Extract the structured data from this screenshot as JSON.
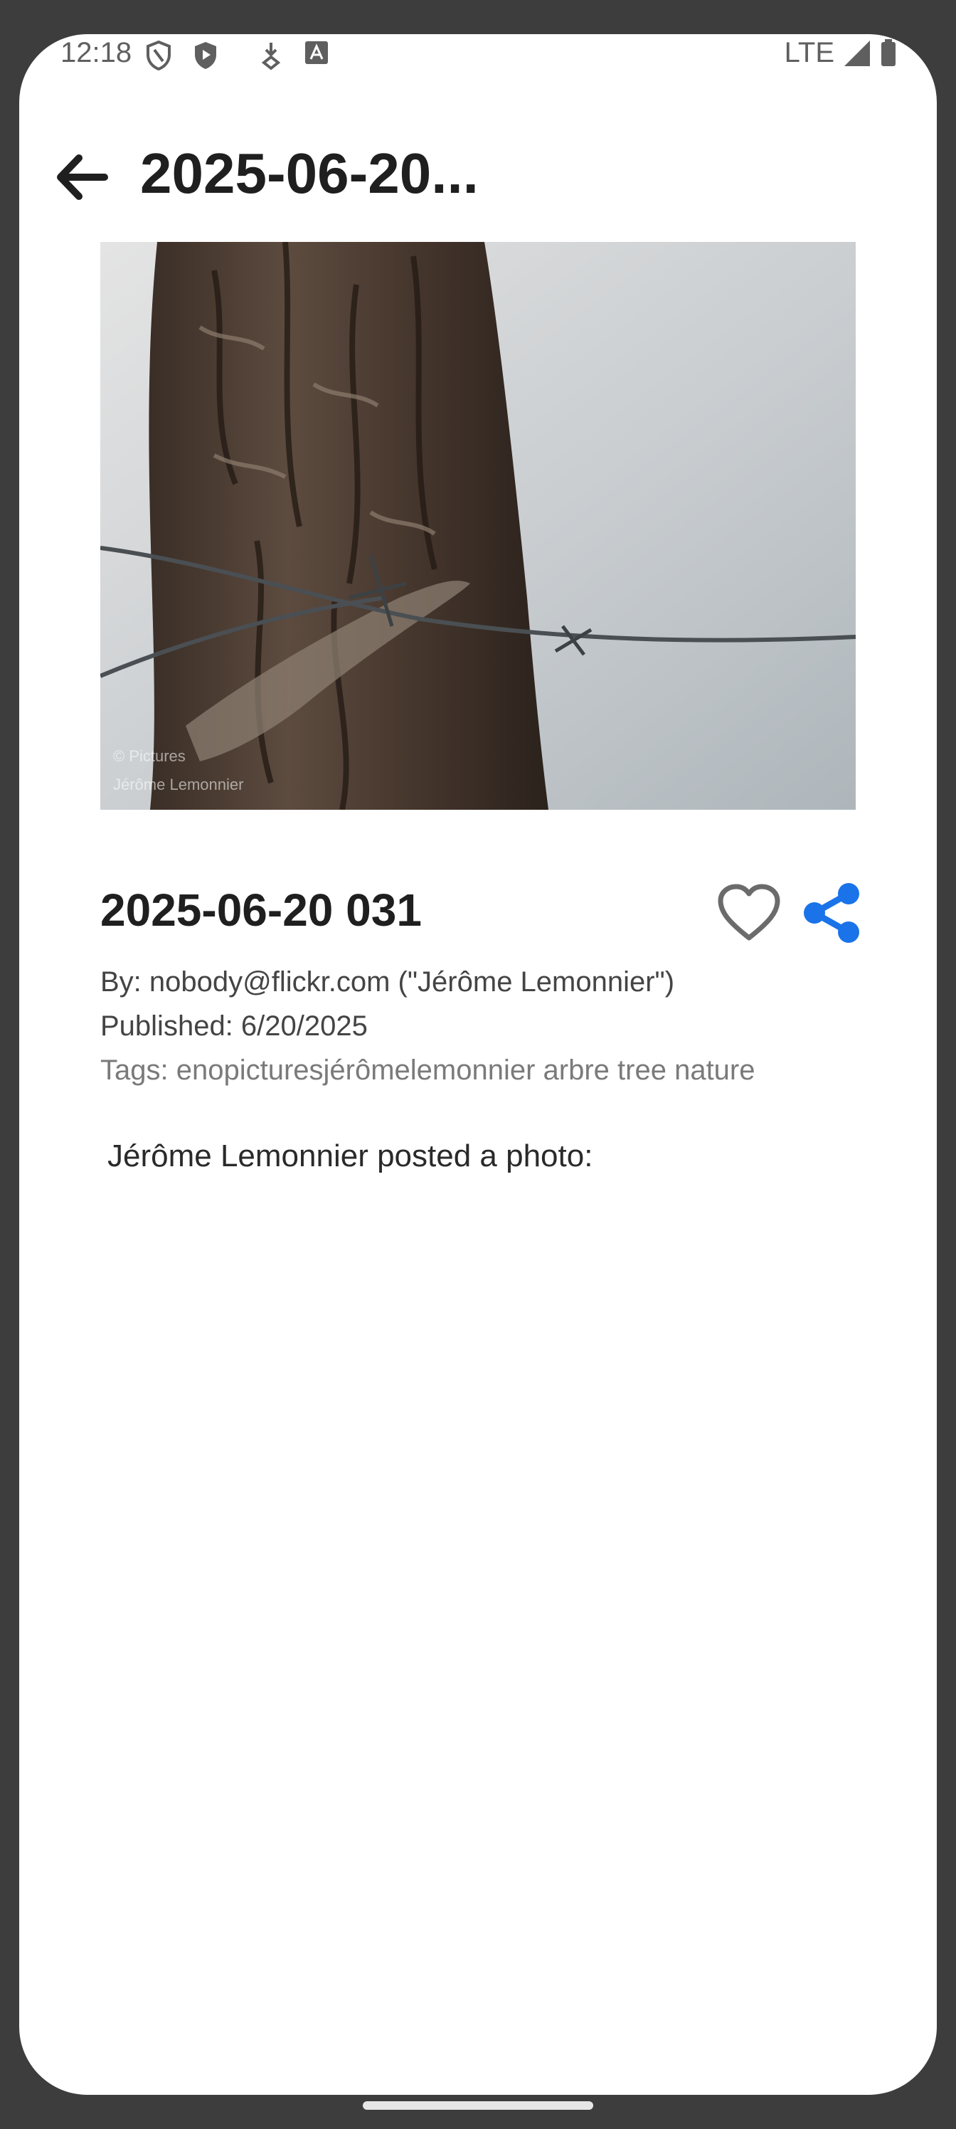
{
  "status_bar": {
    "time": "12:18",
    "network": "LTE",
    "icons": [
      "shield-outline-icon",
      "shield-play-icon",
      "download-arrow-icon",
      "text-a-icon",
      "signal-icon",
      "battery-icon"
    ]
  },
  "app_bar": {
    "title": "2025-06-20...",
    "back_icon": "arrow-left-icon"
  },
  "photo": {
    "description_alt": "tree trunk with barbed wire",
    "watermark": [
      "© Pictures",
      "Jérôme Lemonnier"
    ]
  },
  "details": {
    "title": "2025-06-20 031",
    "author": "By: nobody@flickr.com (\"Jérôme Lemonnier\")",
    "published": "Published: 6/20/2025",
    "tags": "Tags: enopicturesjérômelemonnier arbre tree nature",
    "favorite_icon": "heart-outline-icon",
    "share_icon": "share-icon",
    "share_color": "#1a73e8"
  },
  "description": "Jérôme Lemonnier posted a photo:"
}
